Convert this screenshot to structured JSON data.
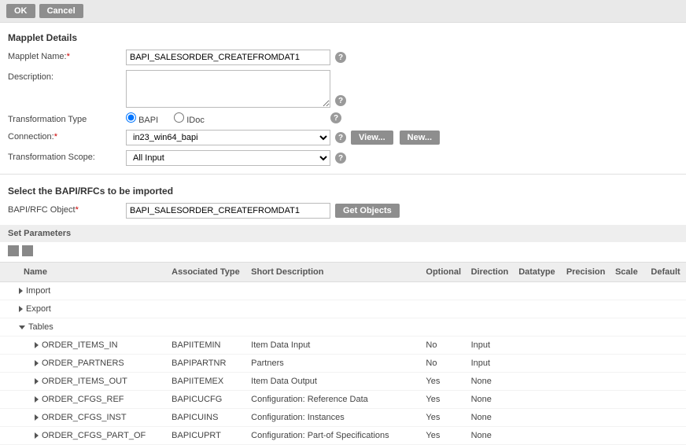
{
  "buttons": {
    "ok": "OK",
    "cancel": "Cancel",
    "view": "View...",
    "new": "New...",
    "get_objects": "Get Objects"
  },
  "section_titles": {
    "mapplet_details": "Mapplet Details",
    "select_bapi": "Select the BAPI/RFCs to be imported",
    "set_params": "Set Parameters"
  },
  "labels": {
    "mapplet_name": "Mapplet Name:",
    "description": "Description:",
    "trans_type": "Transformation Type",
    "connection": "Connection:",
    "trans_scope": "Transformation Scope:",
    "bapi_rfc_object": "BAPI/RFC Object"
  },
  "values": {
    "mapplet_name": "BAPI_SALESORDER_CREATEFROMDAT1",
    "description": "",
    "trans_type_selected": "bapi",
    "trans_type_bapi": "BAPI",
    "trans_type_idoc": "IDoc",
    "connection": "in23_win64_bapi",
    "trans_scope": "All Input",
    "bapi_rfc_object": "BAPI_SALESORDER_CREATEFROMDAT1"
  },
  "help_symbol": "?",
  "req": "*",
  "cols": {
    "name": "Name",
    "assoc": "Associated Type",
    "short": "Short Description",
    "opt": "Optional",
    "dir": "Direction",
    "dt": "Datatype",
    "prec": "Precision",
    "scale": "Scale",
    "def": "Default"
  },
  "groups": {
    "import": "Import",
    "export": "Export",
    "tables": "Tables"
  },
  "rows": [
    {
      "name": "ORDER_ITEMS_IN",
      "assoc": "BAPIITEMIN",
      "short": "Item Data Input",
      "opt": "No",
      "dir": "Input"
    },
    {
      "name": "ORDER_PARTNERS",
      "assoc": "BAPIPARTNR",
      "short": "Partners",
      "opt": "No",
      "dir": "Input"
    },
    {
      "name": "ORDER_ITEMS_OUT",
      "assoc": "BAPIITEMEX",
      "short": "Item Data Output",
      "opt": "Yes",
      "dir": "None"
    },
    {
      "name": "ORDER_CFGS_REF",
      "assoc": "BAPICUCFG",
      "short": "Configuration: Reference Data",
      "opt": "Yes",
      "dir": "None"
    },
    {
      "name": "ORDER_CFGS_INST",
      "assoc": "BAPICUINS",
      "short": "Configuration: Instances",
      "opt": "Yes",
      "dir": "None"
    },
    {
      "name": "ORDER_CFGS_PART_OF",
      "assoc": "BAPICUPRT",
      "short": "Configuration: Part-of Specifications",
      "opt": "Yes",
      "dir": "None"
    }
  ]
}
